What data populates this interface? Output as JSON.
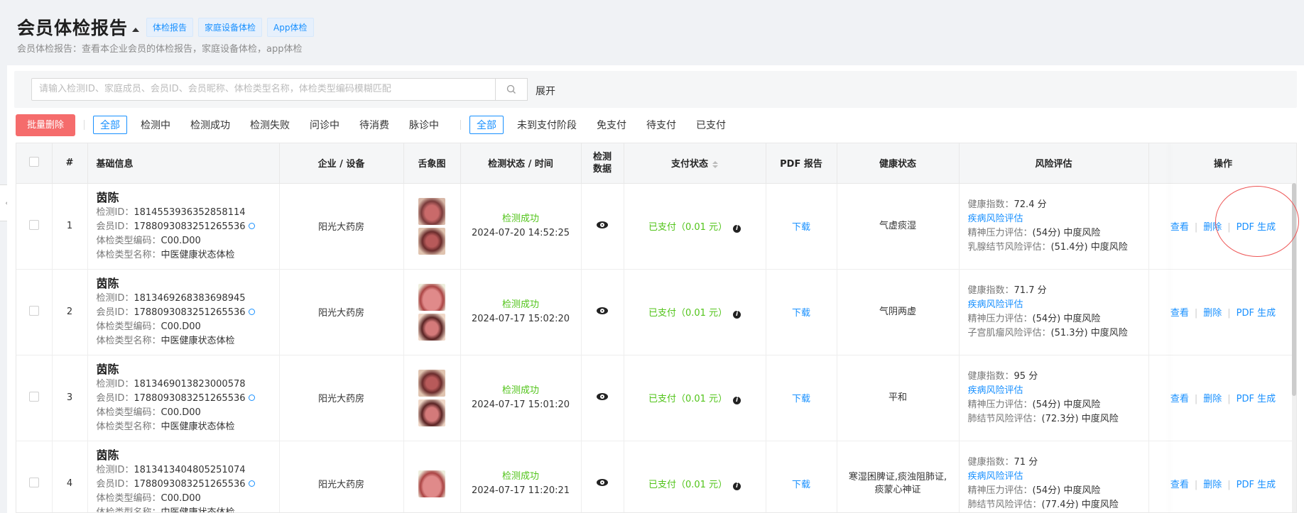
{
  "header": {
    "title": "会员体检报告",
    "tags": [
      "体检报告",
      "家庭设备体检",
      "App体检"
    ],
    "subtitle": "会员体检报告：查看本企业会员的体检报告，家庭设备体检，app体检"
  },
  "search": {
    "placeholder": "请输入检测ID、家庭成员、会员ID、会员昵称、体检类型名称，体检类型编码模糊匹配",
    "expand_label": "展开"
  },
  "filters": {
    "batch_delete": "批量删除",
    "status_group": [
      "全部",
      "检测中",
      "检测成功",
      "检测失败",
      "问诊中",
      "待消费",
      "脉诊中"
    ],
    "pay_group": [
      "全部",
      "未到支付阶段",
      "免支付",
      "待支付",
      "已支付"
    ]
  },
  "table": {
    "headers": {
      "index": "#",
      "basic": "基础信息",
      "org": "企业 / 设备",
      "tongue": "舌象图",
      "status_time": "检测状态 / 时间",
      "data_l1": "检测",
      "data_l2": "数据",
      "pay": "支付状态",
      "pdf": "PDF 报告",
      "health": "健康状态",
      "risk": "风险评估",
      "ops": "操作"
    },
    "labels": {
      "detect_id": "检测ID：",
      "member_id": "会员ID：",
      "type_code": "体检类型编码：",
      "type_name": "体检类型名称：",
      "health_index": "健康指数：",
      "disease_risk": "疾病风险评估",
      "mental": "精神压力评估："
    },
    "rows": [
      {
        "index": "1",
        "name": "茵陈",
        "detect_id": "1814553936352858114",
        "member_id": "1788093083251265536",
        "type_code": "C00.D00",
        "type_name": "中医健康状态体检",
        "org": "阳光大药房",
        "status": "检测成功",
        "time": "2024-07-20 14:52:25",
        "pay": "已支付（0.01 元）",
        "pdf": "下载",
        "health": "气虚痰湿",
        "health_index": "72.4 分",
        "mental_value": "(54分) 中度风险",
        "extra_label": "乳腺结节风险评估：",
        "extra_value": "(51.4分) 中度风险",
        "ops": [
          "查看",
          "删除",
          "PDF 生成"
        ]
      },
      {
        "index": "2",
        "name": "茵陈",
        "detect_id": "1813469268383698945",
        "member_id": "1788093083251265536",
        "type_code": "C00.D00",
        "type_name": "中医健康状态体检",
        "org": "阳光大药房",
        "status": "检测成功",
        "time": "2024-07-17 15:02:20",
        "pay": "已支付（0.01 元）",
        "pdf": "下载",
        "health": "气阴两虚",
        "health_index": "71.7 分",
        "mental_value": "(54分) 中度风险",
        "extra_label": "子宫肌瘤风险评估：",
        "extra_value": "(51.3分) 中度风险",
        "ops": [
          "查看",
          "删除",
          "PDF 生成"
        ]
      },
      {
        "index": "3",
        "name": "茵陈",
        "detect_id": "1813469013823000578",
        "member_id": "1788093083251265536",
        "type_code": "C00.D00",
        "type_name": "中医健康状态体检",
        "org": "阳光大药房",
        "status": "检测成功",
        "time": "2024-07-17 15:01:20",
        "pay": "已支付（0.01 元）",
        "pdf": "下载",
        "health": "平和",
        "health_index": "95 分",
        "mental_value": "(54分) 中度风险",
        "extra_label": "肺结节风险评估：",
        "extra_value": "(72.3分) 中度风险",
        "ops": [
          "查看",
          "删除",
          "PDF 生成"
        ]
      },
      {
        "index": "4",
        "name": "茵陈",
        "detect_id": "1813413404805251074",
        "member_id": "1788093083251265536",
        "type_code": "C00.D00",
        "type_name": "中医健康状态体检",
        "org": "阳光大药房",
        "status": "检测成功",
        "time": "2024-07-17 11:20:21",
        "pay": "已支付（0.01 元）",
        "pdf": "下载",
        "health": "寒湿困脾证,痰浊阻肺证,痰蒙心神证",
        "health_index": "71 分",
        "mental_value": "(54分) 中度风险",
        "extra_label": "肺结节风险评估：",
        "extra_value": "(77.4分) 中度风险",
        "ops": [
          "查看",
          "删除",
          "PDF 生成"
        ]
      }
    ]
  }
}
